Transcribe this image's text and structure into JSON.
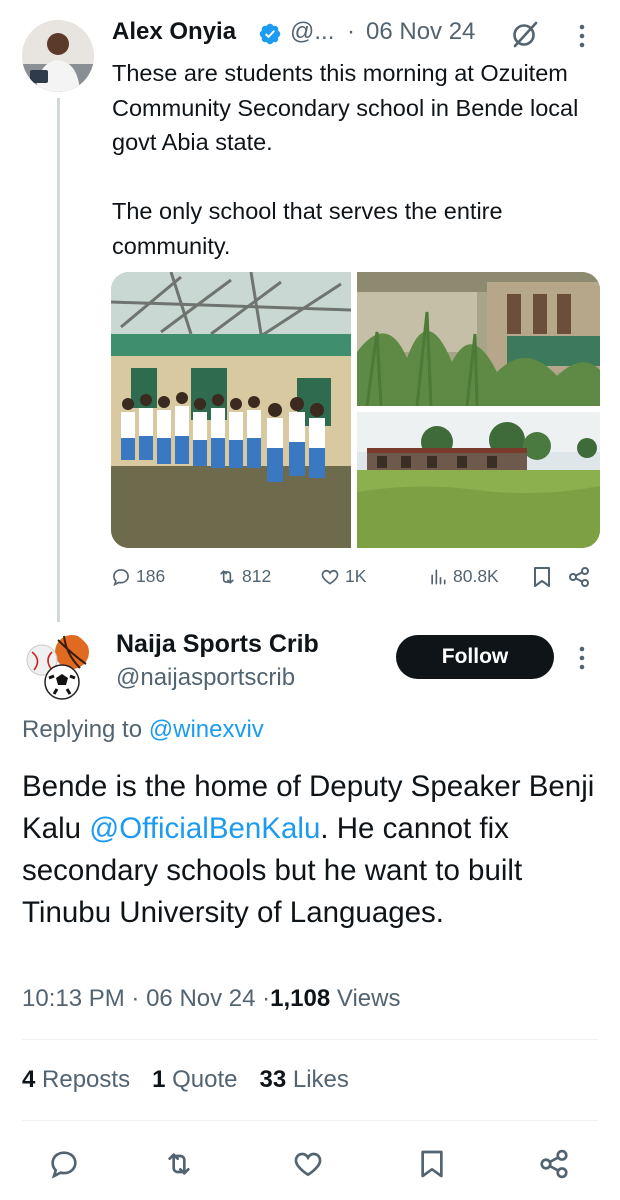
{
  "parent_tweet": {
    "author_name": "Alex Onyia",
    "handle": "@...",
    "separator": "·",
    "date": "06 Nov 24",
    "text": "These are students this morning at Ozuitem Community Secondary school in Bende local govt Abia state.\n\nThe only school that serves the entire community.",
    "media": [
      "students-outside-damaged-school-photo",
      "overgrown-classroom-block-photo",
      "abandoned-building-in-grass-photo"
    ],
    "actions": {
      "replies": "186",
      "reposts": "812",
      "likes": "1K",
      "views": "80.8K"
    }
  },
  "reply_tweet": {
    "author_name": "Naija Sports Crib",
    "handle": "@naijasportscrib",
    "follow_label": "Follow",
    "replying_prefix": "Replying to",
    "replying_to": "@winexviv",
    "text_before_mention": "Bende is the home of Deputy Speaker Benji Kalu ",
    "mention": "@OfficialBenKalu",
    "text_after_mention": ". He cannot fix secondary schools but he want to built Tinubu University of Languages.",
    "time": "10:13 PM",
    "sep1": "·",
    "date": "06 Nov 24",
    "sep2": "·",
    "views_count": "1,108",
    "views_label": "Views",
    "reposts_count": "4",
    "reposts_label": "Reposts",
    "quotes_count": "1",
    "quotes_label": "Quote",
    "likes_count": "33",
    "likes_label": "Likes"
  },
  "icons": [
    "reply-icon",
    "repost-icon",
    "like-icon",
    "views-icon",
    "bookmark-icon",
    "share-icon",
    "grok-icon",
    "more-icon",
    "verified-icon"
  ],
  "colors": {
    "link": "#1d9bf0",
    "secondary_text": "#536471",
    "primary_text": "#0f1419",
    "follow_button": "#0f1419",
    "verified": "#1d9bf0"
  }
}
